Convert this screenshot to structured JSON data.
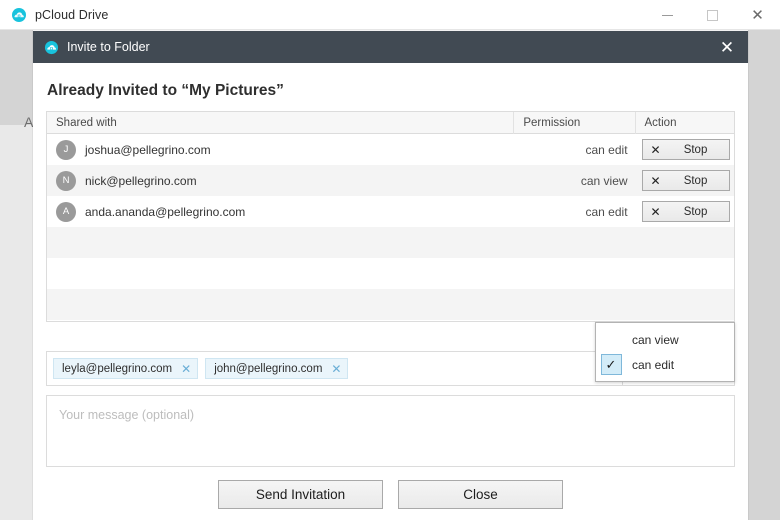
{
  "app": {
    "title": "pCloud Drive",
    "logo_icon": "pcloud-logo-icon",
    "window_controls": {
      "minimize": "minimize-icon",
      "maximize": "maximize-icon",
      "close": "close-icon"
    },
    "background_letter": "A"
  },
  "dialog": {
    "title": "Invite to Folder",
    "logo_icon": "pcloud-logo-icon",
    "close_label": "✕",
    "section_title": "Already Invited to “My Pictures”",
    "table": {
      "headers": {
        "shared_with": "Shared with",
        "permission": "Permission",
        "action": "Action"
      },
      "rows": [
        {
          "initial": "J",
          "email": "joshua@pellegrino.com",
          "permission": "can edit",
          "action_label": "Stop",
          "action_icon": "✕"
        },
        {
          "initial": "N",
          "email": "nick@pellegrino.com",
          "permission": "can view",
          "action_label": "Stop",
          "action_icon": "✕"
        },
        {
          "initial": "A",
          "email": "anda.ananda@pellegrino.com",
          "permission": "can edit",
          "action_label": "Stop",
          "action_icon": "✕"
        }
      ]
    },
    "invite": {
      "chips": [
        {
          "email": "leyla@pellegrino.com",
          "remove_icon": "✕"
        },
        {
          "email": "john@pellegrino.com",
          "remove_icon": "✕"
        }
      ],
      "permission_value": "can edit",
      "caret_icon": "▾"
    },
    "permission_dropdown": {
      "options": [
        {
          "label": "can view",
          "selected": false
        },
        {
          "label": "can edit",
          "selected": true
        }
      ],
      "check_icon": "✓"
    },
    "message": {
      "placeholder": "Your message (optional)",
      "value": ""
    },
    "footer": {
      "send_label": "Send Invitation",
      "close_label": "Close"
    }
  },
  "colors": {
    "header_bg": "#414a53",
    "chip_bg": "#eaf5fb",
    "chip_border": "#cfe6f2",
    "accent_cyan": "#18c3dd",
    "selected_bg": "#d3ecf8",
    "selected_border": "#7fb8da"
  }
}
